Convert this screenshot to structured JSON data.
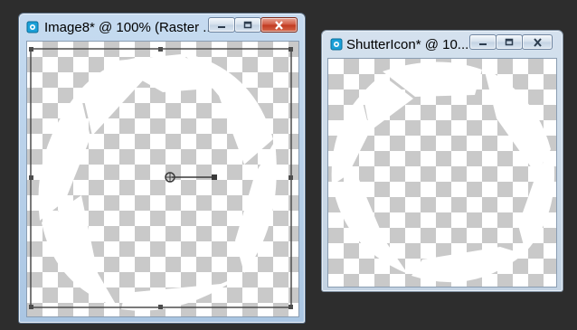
{
  "windows": [
    {
      "title": "Image8* @ 100% (Raster ...",
      "state": "active",
      "close_color": "#c0391f"
    },
    {
      "title": "ShutterIcon* @ 10...",
      "state": "inactive"
    }
  ],
  "icons": {
    "app_icon": "psp-image-icon",
    "minimize": "minimize-icon",
    "restore": "restore-icon",
    "close": "close-icon",
    "pivot": "rotation-pivot-icon"
  },
  "colors": {
    "desktop": "#2d2d2d",
    "checker_dark": "#c9c9c9",
    "checker_light": "#ffffff",
    "shape": "#ffffff",
    "selection_frame": "#4d4d4d"
  }
}
